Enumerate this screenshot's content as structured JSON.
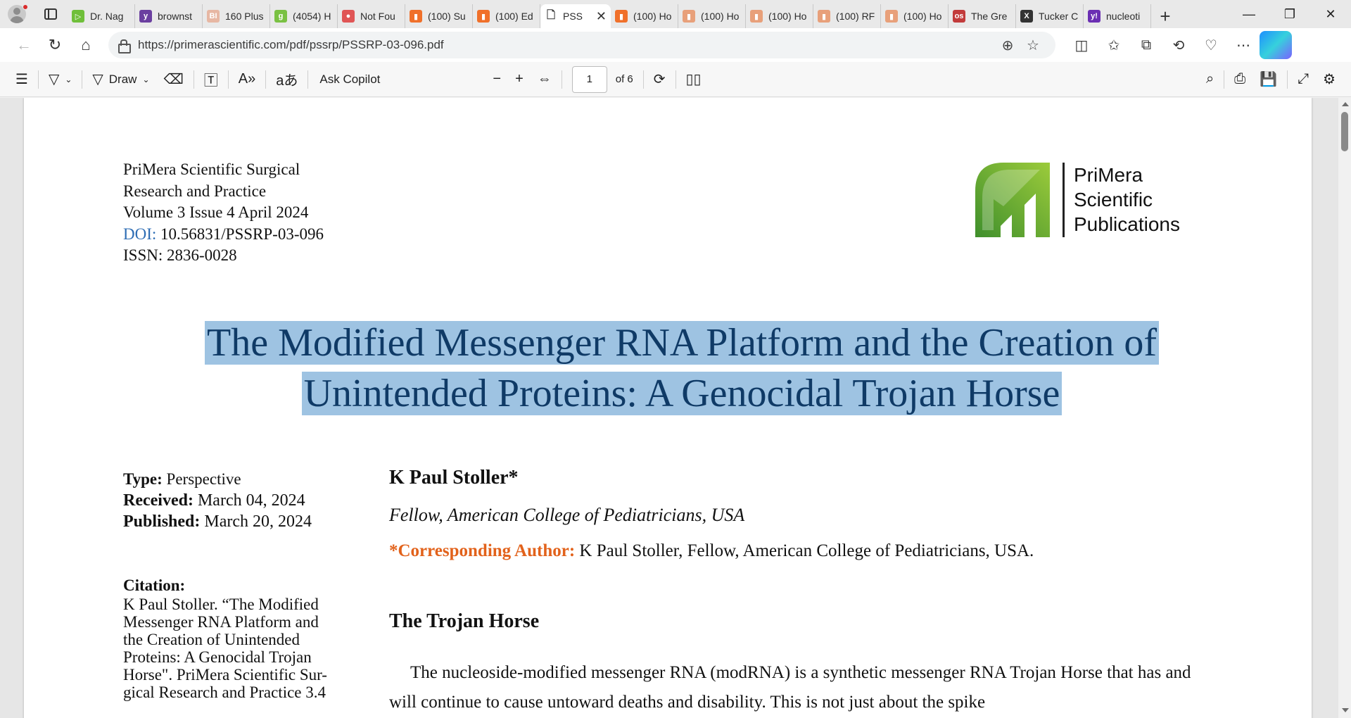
{
  "tabs": [
    {
      "label": "Dr. Nag",
      "color": "#6fbf3a",
      "glyph": "▷"
    },
    {
      "label": "brownst",
      "color": "#6b3fa0",
      "glyph": "y"
    },
    {
      "label": "160 Plus",
      "color": "#e7b7a3",
      "glyph": "BI"
    },
    {
      "label": "(4054) H",
      "color": "#7ac143",
      "glyph": "g"
    },
    {
      "label": "Not Fou",
      "color": "#e05555",
      "glyph": "●"
    },
    {
      "label": "(100) Su",
      "color": "#f0702a",
      "glyph": "▮"
    },
    {
      "label": "(100) Ed",
      "color": "#f0702a",
      "glyph": "▮"
    },
    {
      "label": "PSS",
      "color": "#ffffff",
      "glyph": "🗋",
      "active": true
    },
    {
      "label": "(100) Ho",
      "color": "#f0702a",
      "glyph": "▮"
    },
    {
      "label": "(100) Ho",
      "color": "#e8a07a",
      "glyph": "▮"
    },
    {
      "label": "(100) Ho",
      "color": "#e8a07a",
      "glyph": "▮"
    },
    {
      "label": "(100) RF",
      "color": "#e8a07a",
      "glyph": "▮"
    },
    {
      "label": "(100) Ho",
      "color": "#e8a07a",
      "glyph": "▮"
    },
    {
      "label": "The Gre",
      "color": "#c23b3b",
      "glyph": "os"
    },
    {
      "label": "Tucker C",
      "color": "#333333",
      "glyph": "X"
    },
    {
      "label": "nucleoti",
      "color": "#6b2fb3",
      "glyph": "y!"
    }
  ],
  "address": {
    "url": "https://primerascientific.com/pdf/pssrp/PSSRP-03-096.pdf"
  },
  "pdf_toolbar": {
    "draw_label": "Draw",
    "ask_copilot": "Ask Copilot",
    "page_current": "1",
    "page_total": "of 6"
  },
  "doc": {
    "journal_lines": [
      "PriMera Scientific Surgical",
      "Research and Practice",
      "Volume 3 Issue 4 April 2024"
    ],
    "doi_label": "DOI:",
    "doi_value": " 10.56831/PSSRP-03-096",
    "issn": "ISSN: 2836-0028",
    "logo_lines": [
      "PriMera",
      "Scientific",
      "Publications"
    ],
    "title_line1": "The Modified Messenger RNA Platform and the Creation of",
    "title_line2": "Unintended Proteins: A Genocidal Trojan Horse",
    "type_label": "Type:",
    "type_value": " Perspective",
    "received_label": "Received:",
    "received_value": " March 04, 2024",
    "published_label": "Published:",
    "published_value": " March 20, 2024",
    "citation_label": "Citation:",
    "citation_text": "K Paul Stoller. “The Modified Messenger RNA Platform and the Creation of Unintended Proteins: A Genocidal Trojan Horse\". PriMera Scientific Sur-gical Research and Practice 3.4",
    "author": "K Paul Stoller*",
    "affiliation": "Fellow, American College of Pediatricians, USA",
    "corr_label": "*Corresponding Author:",
    "corr_text": " K Paul Stoller, Fellow, American College of Pediatricians, USA.",
    "section_heading": "The Trojan Horse",
    "body_text": "The nucleoside-modified messenger RNA (modRNA) is a synthetic messenger RNA Trojan Horse that has and will continue to cause untoward deaths and disability. This is not just about the spike"
  },
  "colors": {
    "title": "#0f3a66",
    "highlight": "#9ec3e2",
    "doi": "#2e6db4",
    "corr": "#e2621b",
    "logo_green": "#6cb33f"
  }
}
